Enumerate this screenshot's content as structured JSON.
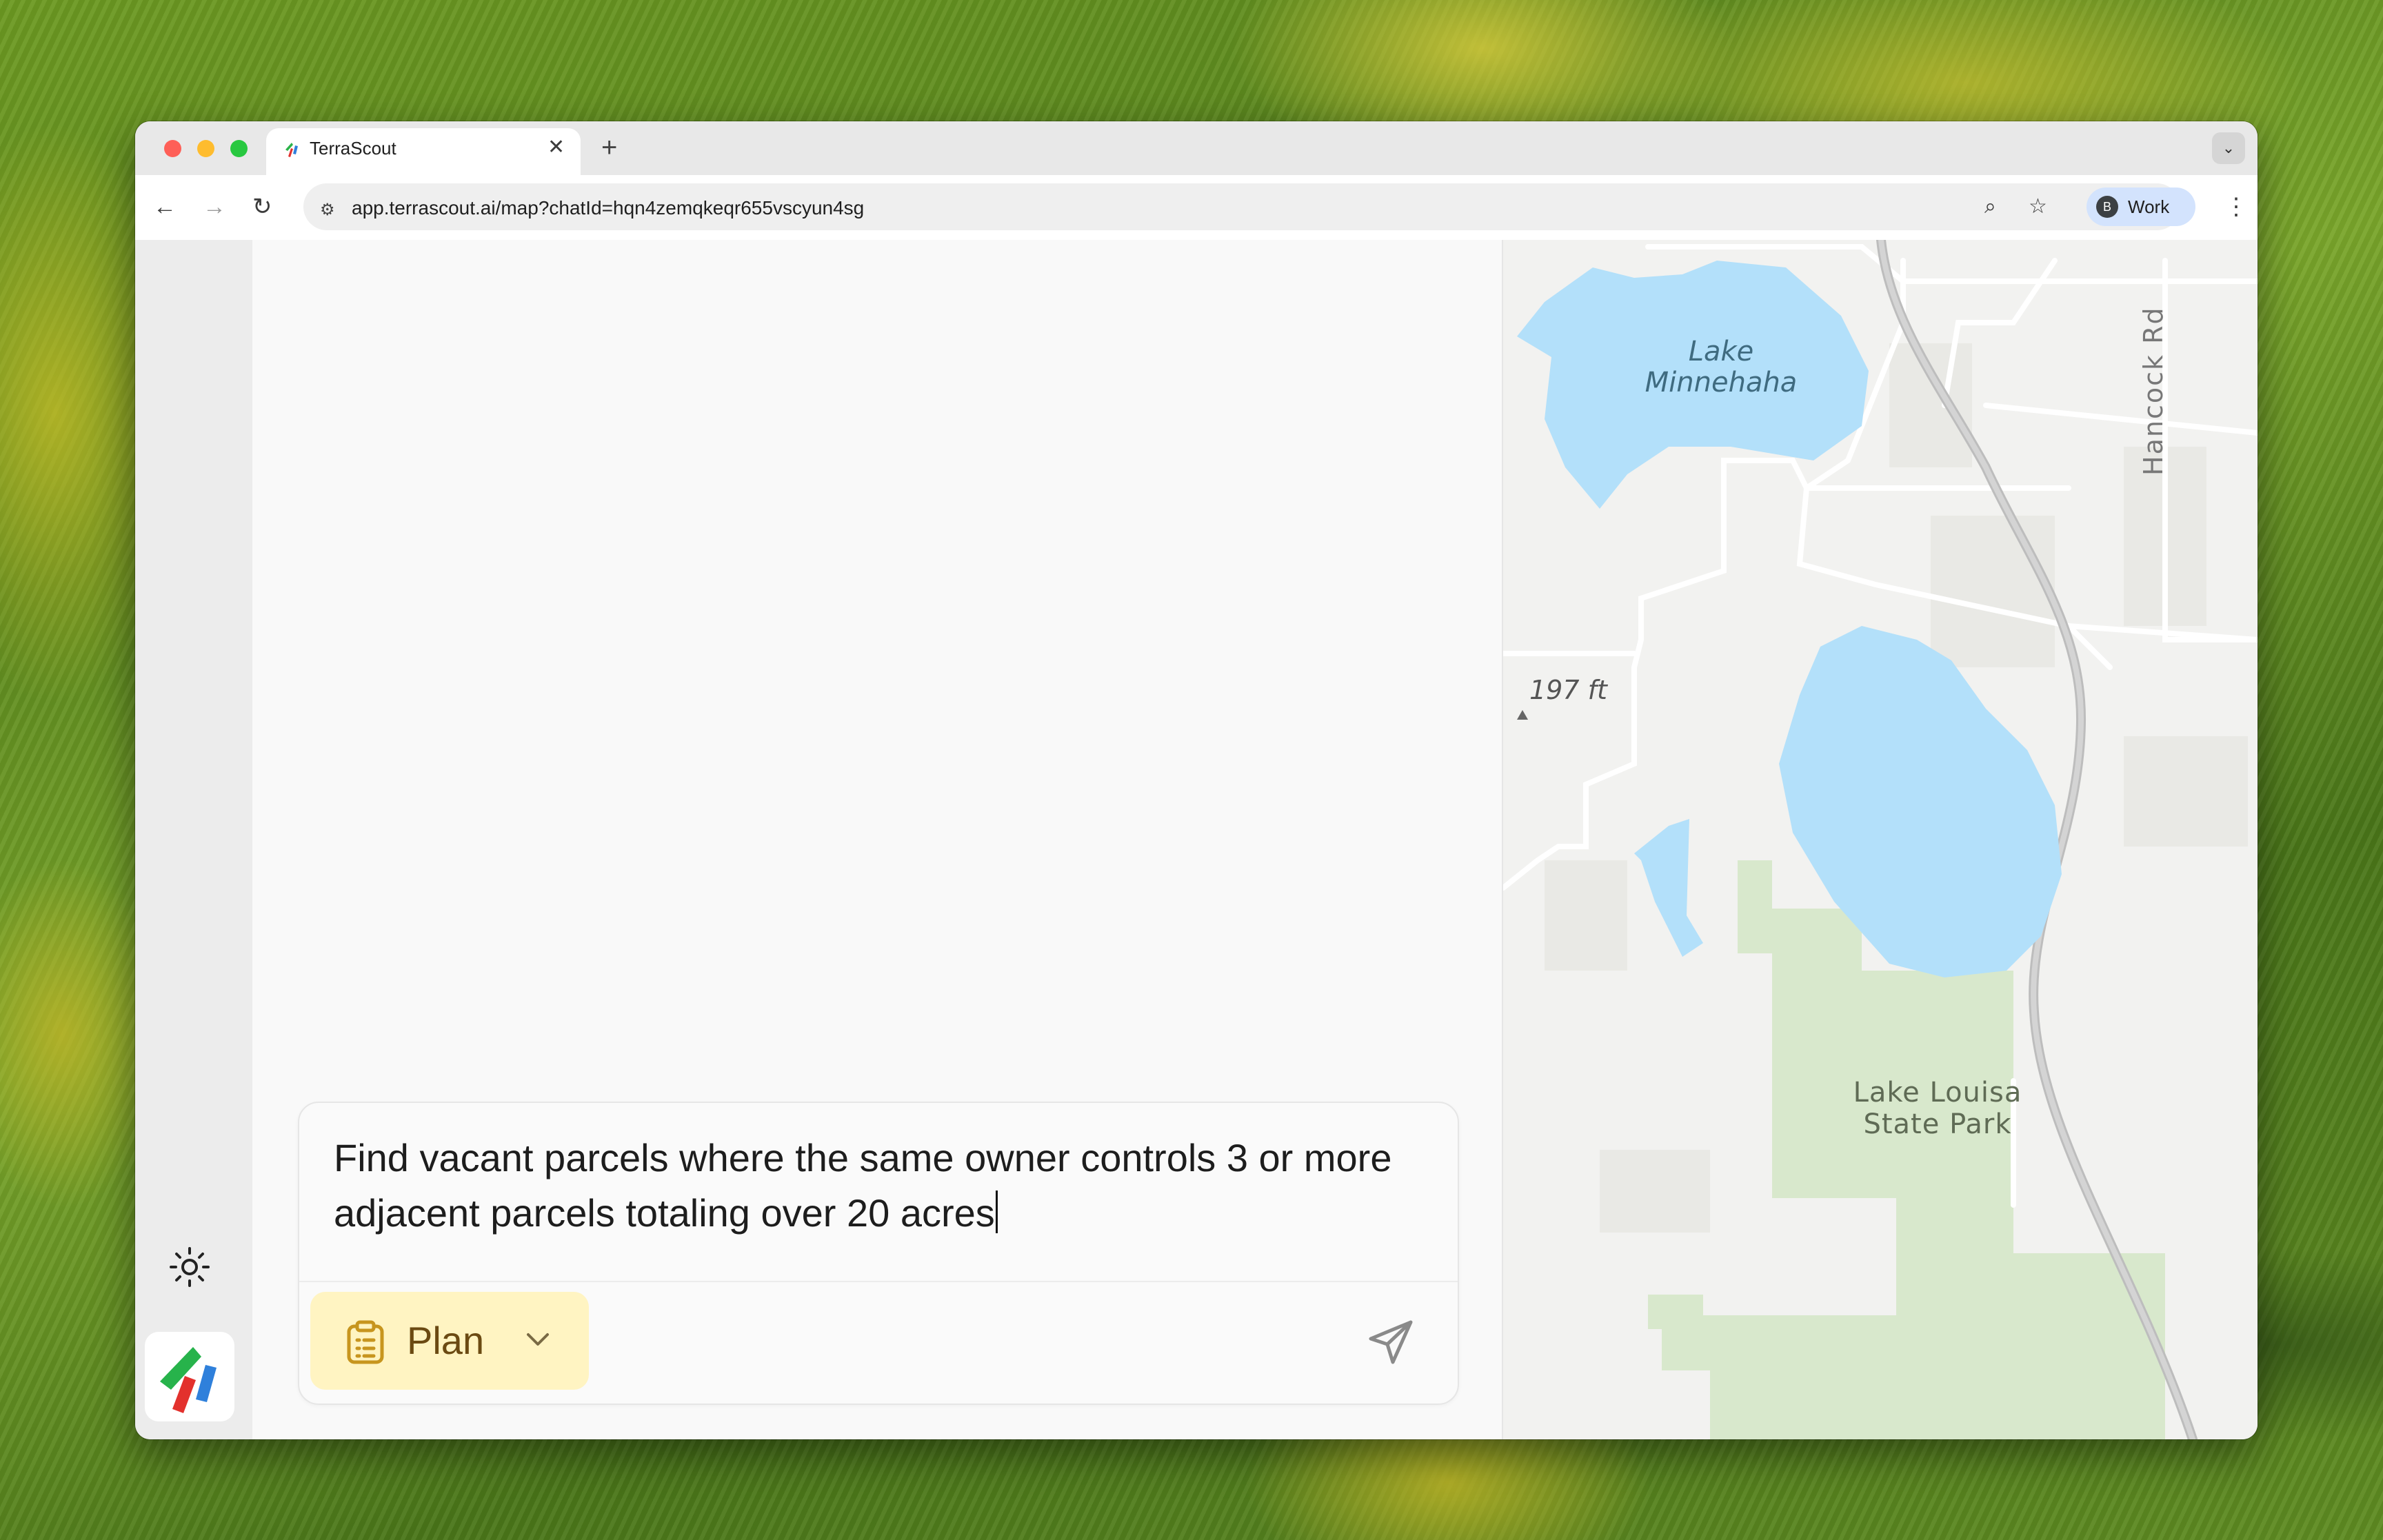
{
  "browser": {
    "tab_title": "TerraScout",
    "url": "app.terrascout.ai/map?chatId=hqn4zemqkeqr655vscyun4sg",
    "profile_initial": "B",
    "profile_label": "Work"
  },
  "composer": {
    "text": "Find vacant parcels where the same owner controls 3 or more adjacent parcels totaling over 20 acres",
    "mode_label": "Plan"
  },
  "map": {
    "labels": {
      "lake_minnehaha_1": "Lake",
      "lake_minnehaha_2": "Minnehaha",
      "elevation": "197 ft",
      "road": "Hancock Rd",
      "park_1": "Lake Louisa",
      "park_2": "State Park"
    },
    "colors": {
      "water": "#b3e0fa",
      "park": "#d8e8cc",
      "land": "#f2f2f0",
      "road": "#ffffff"
    }
  }
}
